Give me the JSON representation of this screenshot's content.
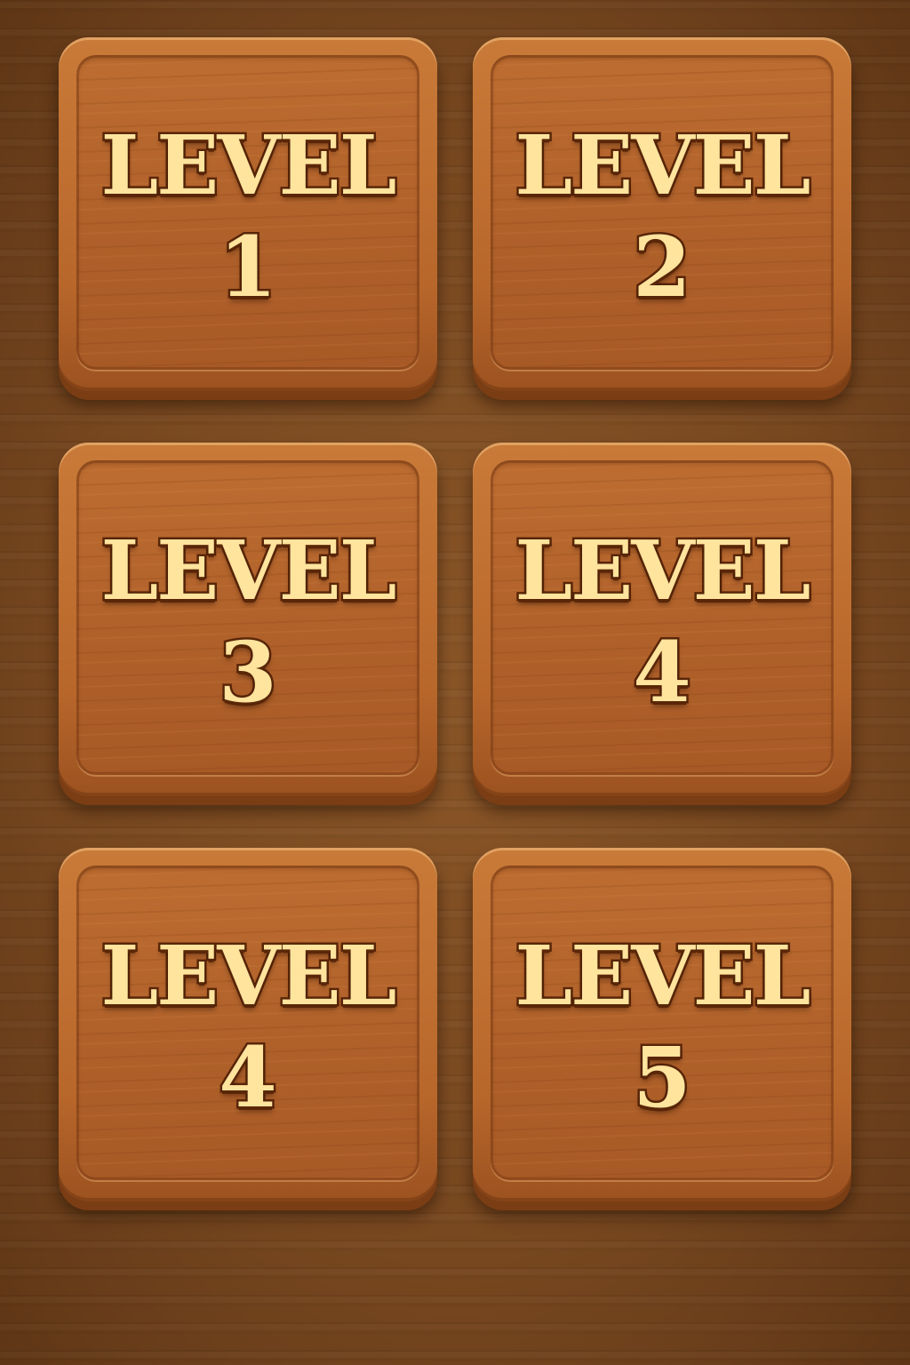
{
  "colors": {
    "background": "#7a4a22",
    "tile_wood": "#b4652b",
    "tile_edge": "#7a3d14",
    "text_fill": "#ffe49e",
    "text_outline": "#5a2608"
  },
  "level_tiles": [
    {
      "label": "LEVEL",
      "number": "1"
    },
    {
      "label": "LEVEL",
      "number": "2"
    },
    {
      "label": "LEVEL",
      "number": "3"
    },
    {
      "label": "LEVEL",
      "number": "4"
    },
    {
      "label": "LEVEL",
      "number": "4"
    },
    {
      "label": "LEVEL",
      "number": "5"
    }
  ]
}
